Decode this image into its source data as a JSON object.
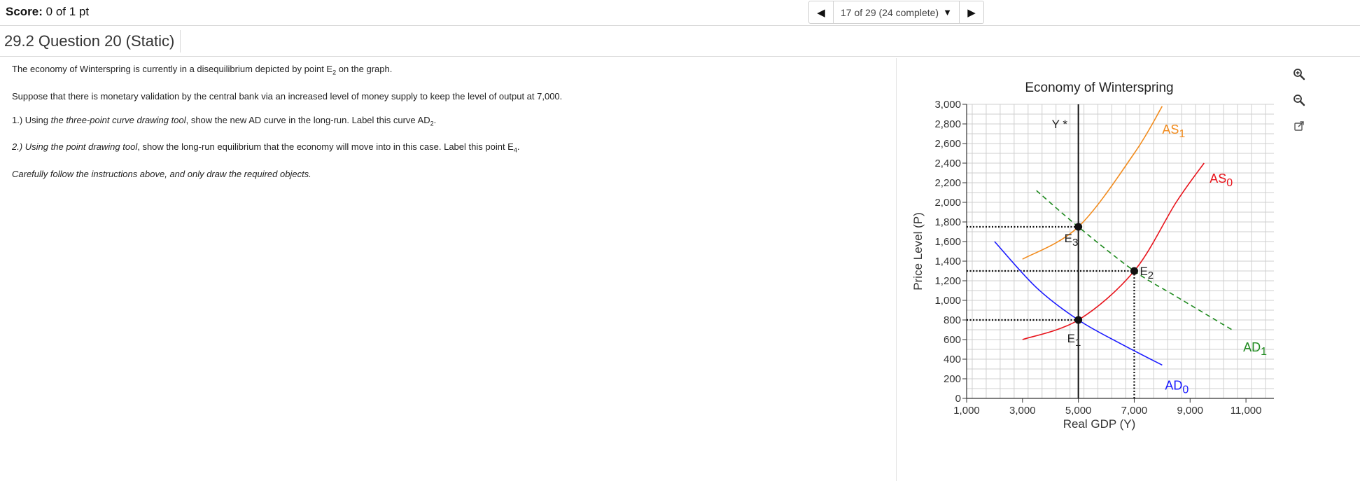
{
  "header": {
    "score_label": "Score:",
    "score_value": "0 of 1 pt",
    "progress": "17 of 29 (24 complete)"
  },
  "question": {
    "title": "29.2 Question 20 (Static)"
  },
  "instructions": {
    "p1_pre": "The economy of Winterspring is currently in a disequilibrium depicted by point E",
    "p1_sub": "2",
    "p1_post": " on the graph.",
    "p2": "Suppose that there is monetary validation by the central bank via an increased level of money supply to keep the level of output at 7,000.",
    "p3_num": "1.) Using ",
    "p3_tool": "the three-point curve drawing tool",
    "p3_mid": ", show the new AD curve in the long-run. Label this curve AD",
    "p3_sub": "2",
    "p3_end": ".",
    "p4_num": "2.) Using the point drawing tool",
    "p4_mid": ", show the long-run equilibrium that the economy will move into in this case. Label this point E",
    "p4_sub": "4",
    "p4_end": ".",
    "p5": "Carefully follow the instructions above, and only draw the required objects."
  },
  "chart_data": {
    "type": "line",
    "title": "Economy of Winterspring",
    "xlabel": "Real GDP (Y)",
    "ylabel": "Price Level (P)",
    "xlim": [
      1000,
      12000
    ],
    "ylim": [
      0,
      3000
    ],
    "x_ticks": [
      1000,
      3000,
      5000,
      7000,
      9000,
      11000
    ],
    "x_tick_labels": [
      "1,000",
      "3,000",
      "5,000",
      "7,000",
      "9,000",
      "11,000"
    ],
    "y_ticks": [
      0,
      200,
      400,
      600,
      800,
      1000,
      1200,
      1400,
      1600,
      1800,
      2000,
      2200,
      2400,
      2600,
      2800,
      3000
    ],
    "y_tick_labels": [
      "0",
      "200",
      "400",
      "600",
      "800",
      "1,000",
      "1,200",
      "1,400",
      "1,600",
      "1,800",
      "2,000",
      "2,200",
      "2,400",
      "2,600",
      "2,800",
      "3,000"
    ],
    "grid": true,
    "potential_output": {
      "label": "Y *",
      "x": 5000
    },
    "series": [
      {
        "name": "AS0",
        "label_main": "AS",
        "label_sub": "0",
        "color": "#e8141c",
        "style": "solid",
        "points": [
          [
            3000,
            600
          ],
          [
            5000,
            800
          ],
          [
            7000,
            1300
          ],
          [
            8500,
            2000
          ],
          [
            9500,
            2400
          ]
        ]
      },
      {
        "name": "AS1",
        "label_main": "AS",
        "label_sub": "1",
        "color": "#f28c1e",
        "style": "solid",
        "points": [
          [
            3000,
            1420
          ],
          [
            5000,
            1750
          ],
          [
            7000,
            2500
          ],
          [
            8000,
            2980
          ]
        ]
      },
      {
        "name": "AD0",
        "label_main": "AD",
        "label_sub": "0",
        "color": "#1a1aff",
        "style": "solid",
        "points": [
          [
            2000,
            1600
          ],
          [
            3500,
            1130
          ],
          [
            5000,
            800
          ],
          [
            6500,
            560
          ],
          [
            8000,
            340
          ]
        ]
      },
      {
        "name": "AD1",
        "label_main": "AD",
        "label_sub": "1",
        "color": "#1f8a1f",
        "style": "dashed",
        "points": [
          [
            3500,
            2120
          ],
          [
            5000,
            1750
          ],
          [
            7000,
            1300
          ],
          [
            8500,
            1040
          ],
          [
            10500,
            700
          ]
        ]
      }
    ],
    "equilibria": [
      {
        "label_main": "E",
        "label_sub": "1",
        "x": 5000,
        "y": 800
      },
      {
        "label_main": "E",
        "label_sub": "2",
        "x": 7000,
        "y": 1300
      },
      {
        "label_main": "E",
        "label_sub": "3",
        "x": 5000,
        "y": 1750
      }
    ]
  },
  "tools": {
    "zoom_in": "zoom-in-icon",
    "zoom_out": "zoom-out-icon",
    "popout": "popout-icon"
  }
}
